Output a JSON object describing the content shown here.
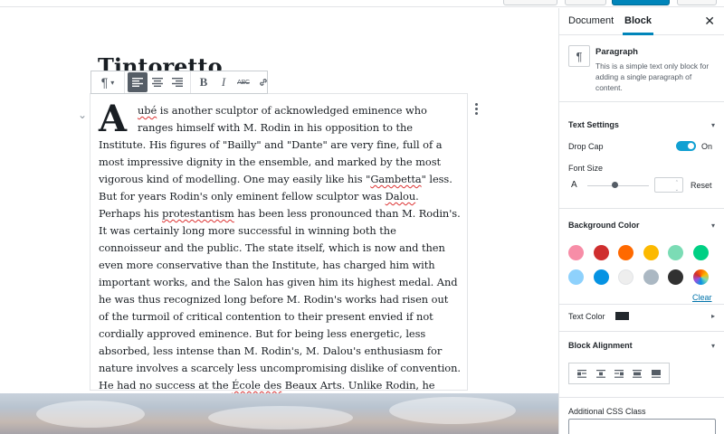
{
  "post": {
    "title": "Tintoretto",
    "dropcap": "A",
    "paragraph_segments": [
      {
        "text": "ubé",
        "misspelled": true
      },
      {
        "text": " is another sculptor of acknowledged eminence who ranges himself with M. Rodin in his opposition to the Institute. His figures of \"Bailly\" and \"Dante\" are very fine, full of a most impressive dignity in the ensemble, and marked by the most vigorous kind of modelling. One may easily like his \""
      },
      {
        "text": "Gambetta",
        "misspelled": true
      },
      {
        "text": "\" less. But for years Rodin's only eminent fellow sculptor was "
      },
      {
        "text": "Dalou",
        "misspelled": true
      },
      {
        "text": ". Perhaps his "
      },
      {
        "text": "protestantism",
        "misspelled": true
      },
      {
        "text": " has been less pronounced than M. Rodin's. It was certainly long more successful in winning both the connoisseur and the public. The state itself, which is now and then even more conservative than the Institute, has charged him with important works, and the Salon has given him its highest medal. And he was thus recognized long before M. Rodin's works had risen out of the turmoil of critical contention to their present envied if not cordially approved eminence. But for being less energetic, less absorbed, less intense than M. Rodin's, M. Dalou's enthusiasm for nature involves a scarcely less uncompromising dislike of convention. He had no success at the "
      },
      {
        "text": "École des",
        "misspelled": true
      },
      {
        "text": " Beaux Arts. Unlike Rodin, he entered those precincts and worked long within them, but never sympathetically or felicitously."
      }
    ]
  },
  "toolbar": {
    "block_type_icon": "¶",
    "block_type_caret": "▾",
    "bold": "B",
    "italic": "I",
    "strikethrough": "ABC",
    "items": [
      "paragraph-icon",
      "align-left-icon",
      "align-center-icon",
      "align-right-icon",
      "bold-icon",
      "italic-icon",
      "strikethrough-icon",
      "link-icon"
    ]
  },
  "editor": {
    "mover_icon": "⌄"
  },
  "sidebar": {
    "tabs": [
      "Document",
      "Block"
    ],
    "active_tab": "Block",
    "close_icon": "✕",
    "block_card": {
      "icon": "¶",
      "title": "Paragraph",
      "description": "This is a simple text only block for adding a single paragraph of content."
    },
    "text_settings": {
      "heading": "Text Settings",
      "drop_cap_label": "Drop Cap",
      "drop_cap_state": "On",
      "drop_cap_enabled": true,
      "font_size_label": "Font Size",
      "font_size_icon": "A",
      "font_size_slider_fraction": 0.45,
      "font_size_value": "",
      "reset_label": "Reset"
    },
    "background_color": {
      "heading": "Background Color",
      "swatches": [
        "#f78da7",
        "#cf2e2e",
        "#ff6900",
        "#fcb900",
        "#7bdcb5",
        "#00d084",
        "#8ed1fc",
        "#0693e3",
        "#eeeeee",
        "#abb8c3",
        "#313131",
        "gradient"
      ],
      "clear_label": "Clear"
    },
    "text_color": {
      "label": "Text Color",
      "value": "#23282d"
    },
    "block_alignment": {
      "heading": "Block Alignment",
      "options": [
        "align-left",
        "align-center",
        "align-right",
        "align-wide",
        "align-full"
      ]
    },
    "additional_css": {
      "label": "Additional CSS Class",
      "value": ""
    },
    "caret": "▾",
    "caret_right": "▸"
  },
  "colors": {
    "accent": "#0085ba",
    "toggle": "#11a0d2",
    "link": "#0073aa"
  }
}
